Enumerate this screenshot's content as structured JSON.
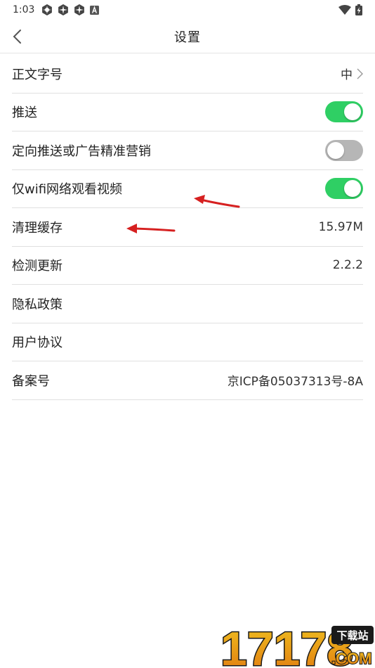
{
  "status_bar": {
    "time": "1:03"
  },
  "header": {
    "title": "设置"
  },
  "settings": {
    "font_size": {
      "label": "正文字号",
      "value": "中"
    },
    "push": {
      "label": "推送",
      "enabled": true
    },
    "targeted_ads": {
      "label": "定向推送或广告精准营销",
      "enabled": false
    },
    "wifi_video": {
      "label": "仅wifi网络观看视频",
      "enabled": true
    },
    "clear_cache": {
      "label": "清理缓存",
      "value": "15.97M"
    },
    "check_update": {
      "label": "检测更新",
      "value": "2.2.2"
    },
    "privacy": {
      "label": "隐私政策"
    },
    "user_agreement": {
      "label": "用户协议"
    },
    "icp": {
      "label": "备案号",
      "value": "京ICP备05037313号-8A"
    }
  },
  "colors": {
    "toggle_on": "#2fcf64",
    "toggle_off": "#b6b6b6",
    "annotation": "#d62020"
  },
  "watermark": {
    "logo_text": "17178",
    "badge_text": "下载站",
    "domain_text": ".COM"
  }
}
